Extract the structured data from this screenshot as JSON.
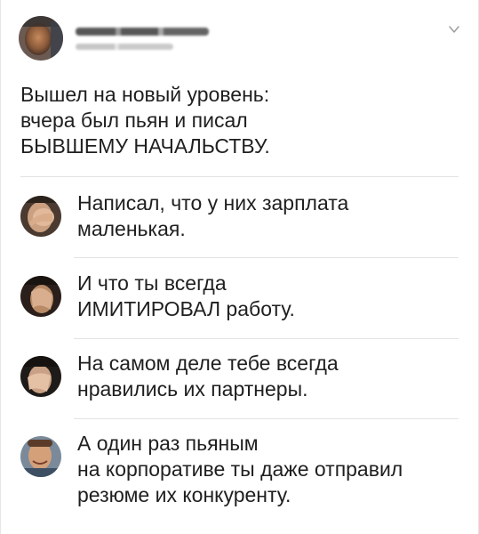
{
  "post": {
    "author": {
      "avatar": "avatar-author",
      "name_blurred": true,
      "handle_blurred": true
    },
    "menu_icon": "chevron-down-icon",
    "lines": [
      "Вышел на новый уровень:",
      "вчера был пьян и писал",
      "БЫВШЕМУ НАЧАЛЬСТВУ."
    ]
  },
  "comments": [
    {
      "avatar": "avatar-face-palm-1",
      "lines": [
        "Написал, что у них зарплата",
        "маленькая."
      ]
    },
    {
      "avatar": "avatar-face-palm-2",
      "lines": [
        "И что ты всегда",
        "ИМИТИРОВАЛ работу."
      ]
    },
    {
      "avatar": "avatar-face-palm-3",
      "lines": [
        "На самом деле тебе всегда",
        "нравились их партнеры."
      ]
    },
    {
      "avatar": "avatar-smiling-man",
      "lines": [
        "А один раз пьяным",
        "на корпоративе ты даже отправил",
        "резюме их конкуренту."
      ]
    }
  ],
  "colors": {
    "text": "#1f1f1f",
    "divider": "#e3e3e3",
    "chevron": "#9a9a9a"
  }
}
